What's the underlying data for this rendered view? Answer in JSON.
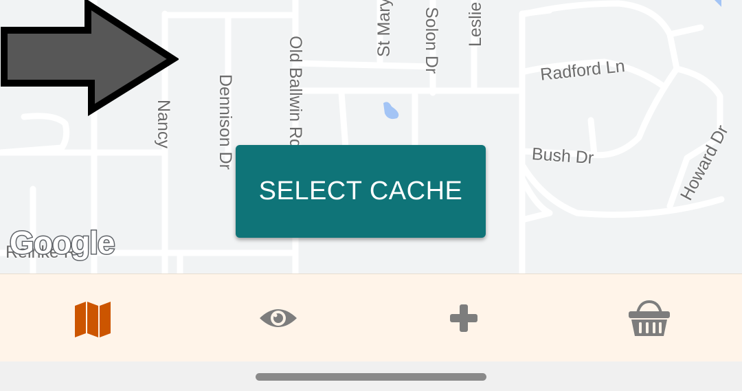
{
  "map": {
    "streets": {
      "st_mary": "St Mary",
      "solon": "Solon Dr",
      "leslie": "Leslie",
      "old_ballwin": "Old Ballwin Rd",
      "dennison": "Dennison Dr",
      "nancy": "Nancy",
      "radford": "Radford Ln",
      "bush": "Bush Dr",
      "howard": "Howard Dr",
      "reinke": "Reinke R"
    },
    "attribution": "Google"
  },
  "action_button": {
    "label": "SELECT CACHE"
  },
  "bottom_nav": {
    "items": [
      {
        "icon": "map-icon",
        "active": true
      },
      {
        "icon": "eye-icon",
        "active": false
      },
      {
        "icon": "plus-icon",
        "active": false
      },
      {
        "icon": "basket-icon",
        "active": false
      }
    ]
  },
  "colors": {
    "button_bg": "#0f7478",
    "nav_bg": "#fff4e9",
    "active_icon": "#cc5500",
    "inactive_icon": "#7d7d7d"
  }
}
